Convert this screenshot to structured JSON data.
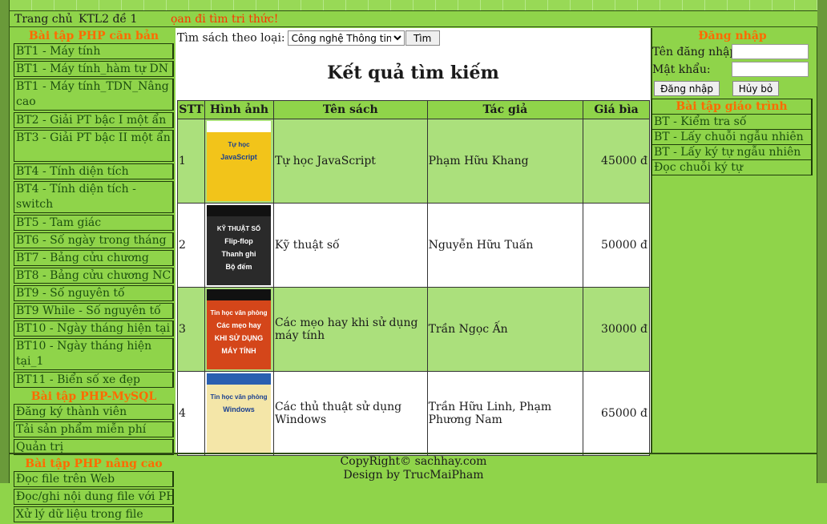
{
  "menu": {
    "home": "Trang chủ",
    "ktl2": "KTL2 đề 1",
    "marquee": "ọan đi tìm tri thức!"
  },
  "left": {
    "sections": [
      {
        "title": "Bài tập PHP căn bản",
        "links": [
          "BT1 - Máy tính",
          "BT1 - Máy tính_hàm tự DN",
          "BT1 - Máy tính_TDN_Nâng cao",
          "BT2 - Giải PT bậc I một ẩn",
          "BT3 - Giải PT bậc II một ẩn",
          "BT4 - Tính diện tích",
          "BT4 - Tính diện tích - switch",
          "BT5 - Tam giác",
          "BT6 - Số ngày trong tháng",
          "BT7 - Bảng cửu chương",
          "BT8 - Bảng cửu chương NC",
          "BT9 - Số nguyên tố",
          "BT9 While - Số nguyên tố",
          "BT10 - Ngày tháng hiện tại",
          "BT10 - Ngày tháng hiện tại_1",
          "BT11 - Biển số xe đẹp"
        ]
      },
      {
        "title": "Bài tập PHP-MySQL",
        "links": [
          "Đăng ký thành viên",
          "Tải sản phẩm miễn phí",
          "Quản trị"
        ]
      },
      {
        "title": "Bài tập PHP nâng cao",
        "links": [
          "Đọc file trên Web",
          "Đọc/ghi nội dung file với PHP",
          "Xử lý dữ liệu trong file"
        ]
      }
    ]
  },
  "search": {
    "label": "Tìm sách theo loại:",
    "selected": "Công nghệ Thông tin",
    "button": "Tìm"
  },
  "results": {
    "title": "Kết quả tìm kiếm",
    "headers": [
      "STT",
      "Hình ảnh",
      "Tên sách",
      "Tác giả",
      "Giá bìa"
    ],
    "rows": [
      {
        "stt": "1",
        "name": "Tự học JavaScript",
        "author": "Phạm Hữu Khang",
        "price": "45000 đ",
        "cover_text": [
          "Tự học",
          "JavaScript"
        ],
        "cover_color": "#f2c41a"
      },
      {
        "stt": "2",
        "name": "Kỹ thuật số",
        "author": "Nguyễn Hữu Tuấn",
        "price": "50000 đ",
        "cover_text": [
          "KỸ THUẬT SỐ",
          "Flip-flop",
          "Thanh ghi",
          "Bộ đếm"
        ],
        "cover_color": "#2a2a2a"
      },
      {
        "stt": "3",
        "name": "Các mẹo hay khi sử dụng máy tính",
        "author": "Trần Ngọc Ấn",
        "price": "30000 đ",
        "cover_text": [
          "Tin học văn phòng",
          "Các mẹo hay",
          "KHI SỬ DỤNG",
          "MÁY TÍNH"
        ],
        "cover_color": "#d4461a"
      },
      {
        "stt": "4",
        "name": "Các thủ thuật sử dụng Windows",
        "author": "Trần Hữu Linh, Phạm Phương Nam",
        "price": "65000 đ",
        "cover_text": [
          "Tin học văn phòng",
          "Windows"
        ],
        "cover_color": "#f4e6a8"
      }
    ]
  },
  "login": {
    "title": "Đăng nhập",
    "username_label": "Tên đăng nhập:",
    "password_label": "Mật khẩu:",
    "login_button": "Đăng nhập",
    "cancel_button": "Hủy bỏ"
  },
  "right": {
    "title": "Bài tập giáo trình",
    "links": [
      "BT - Kiểm tra số",
      "BT - Lấy chuỗi ngẫu nhiên",
      "BT - Lấy ký tự ngẫu nhiên",
      "Đọc chuỗi ký tự"
    ]
  },
  "footer": {
    "line1": "CopyRight© sachhay.com",
    "line2": "Design by TrucMaiPham"
  }
}
